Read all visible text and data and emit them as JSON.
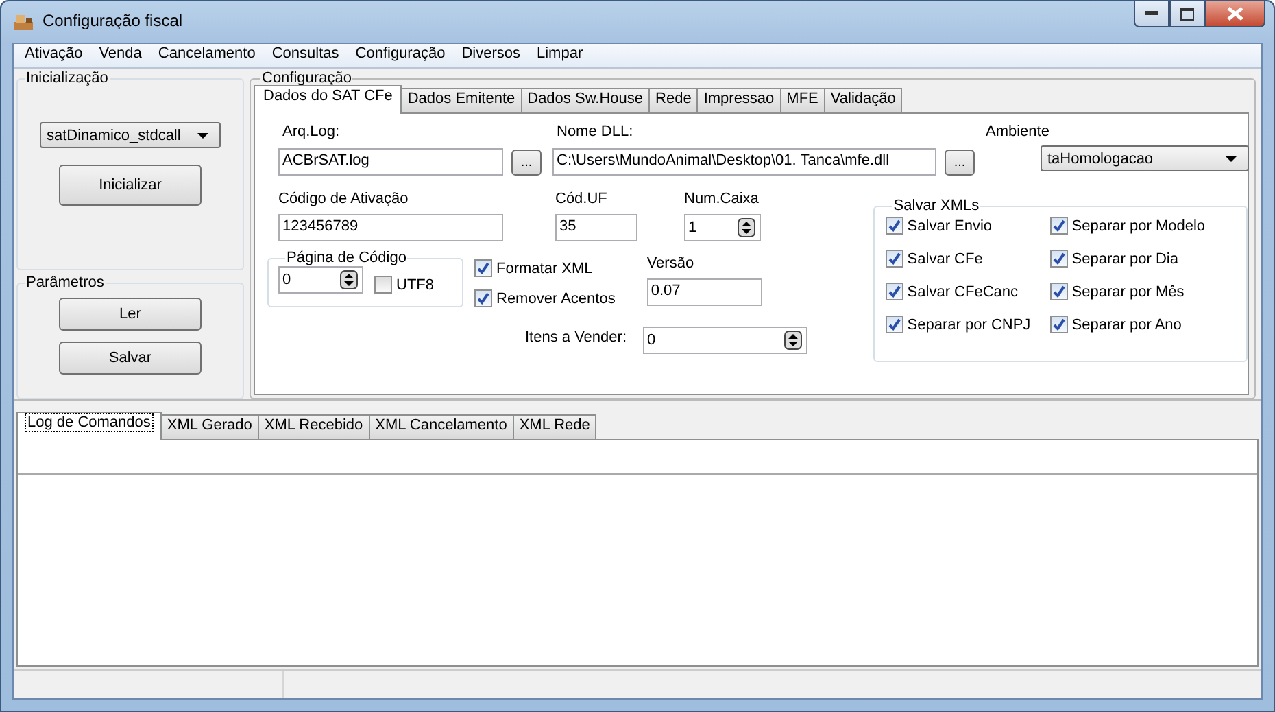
{
  "window": {
    "title": "Configuração fiscal"
  },
  "menu": [
    "Ativação",
    "Venda",
    "Cancelamento",
    "Consultas",
    "Configuração",
    "Diversos",
    "Limpar"
  ],
  "initialization": {
    "title": "Inicialização",
    "model": "satDinamico_stdcall",
    "button": "Inicializar"
  },
  "parameters": {
    "title": "Parâmetros",
    "buttons": [
      "Ler",
      "Salvar"
    ]
  },
  "configuration": {
    "title": "Configuração",
    "tabs": [
      {
        "label": "Dados do SAT CFe",
        "selected": true
      },
      {
        "label": "Dados Emitente",
        "selected": false
      },
      {
        "label": "Dados Sw.House",
        "selected": false
      },
      {
        "label": "Rede",
        "selected": false
      },
      {
        "label": "Impressao",
        "selected": false
      },
      {
        "label": "MFE",
        "selected": false
      },
      {
        "label": "Validação",
        "selected": false
      }
    ],
    "arq_log": {
      "label": "Arq.Log:",
      "value": "ACBrSAT.log",
      "browse": "..."
    },
    "nome_dll": {
      "label": "Nome DLL:",
      "value": "C:\\Users\\MundoAnimal\\Desktop\\01. Tanca\\mfe.dll",
      "browse": "..."
    },
    "ambiente": {
      "label": "Ambiente",
      "value": "taHomologacao"
    },
    "codigo_ativacao": {
      "label": "Código de Ativação",
      "value": "123456789"
    },
    "cod_uf": {
      "label": "Cód.UF",
      "value": "35"
    },
    "num_caixa": {
      "label": "Num.Caixa",
      "value": "1"
    },
    "pagina_codigo": {
      "title": "Página de Código",
      "value": "0",
      "utf8": {
        "label": "UTF8",
        "checked": false
      }
    },
    "options": [
      {
        "label": "Formatar XML",
        "checked": true
      },
      {
        "label": "Remover Acentos",
        "checked": true
      }
    ],
    "versao": {
      "label": "Versão",
      "value": "0.07"
    },
    "itens_vender": {
      "label": "Itens a Vender:",
      "value": "0"
    },
    "salvar_xmls": {
      "title": "Salvar XMLs",
      "options": [
        {
          "label": "Salvar Envio",
          "checked": true
        },
        {
          "label": "Separar por Modelo",
          "checked": true
        },
        {
          "label": "Salvar CFe",
          "checked": true
        },
        {
          "label": "Separar por Dia",
          "checked": true
        },
        {
          "label": "Salvar CFeCanc",
          "checked": true
        },
        {
          "label": "Separar por Mês",
          "checked": true
        },
        {
          "label": "Separar por CNPJ",
          "checked": true
        },
        {
          "label": "Separar por Ano",
          "checked": true
        }
      ]
    }
  },
  "log_tabs": [
    {
      "label": "Log de Comandos",
      "selected": true
    },
    {
      "label": "XML Gerado",
      "selected": false
    },
    {
      "label": "XML Recebido",
      "selected": false
    },
    {
      "label": "XML Cancelamento",
      "selected": false
    },
    {
      "label": "XML Rede",
      "selected": false
    }
  ]
}
